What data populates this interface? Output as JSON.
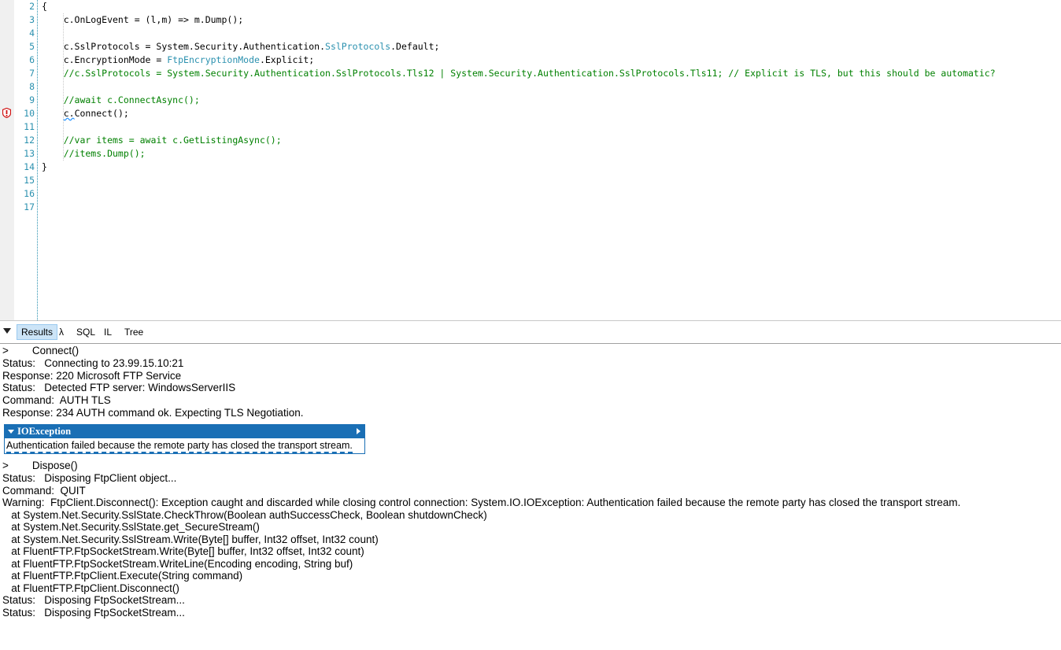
{
  "editor": {
    "lines": [
      {
        "n": "2",
        "segments": [
          {
            "t": "{",
            "c": ""
          }
        ]
      },
      {
        "n": "3",
        "segments": [
          {
            "t": "    c.OnLogEvent = (l,m) => m.Dump();",
            "c": ""
          }
        ]
      },
      {
        "n": "4",
        "segments": [
          {
            "t": "",
            "c": ""
          }
        ]
      },
      {
        "n": "5",
        "segments": [
          {
            "t": "    c.SslProtocols = System.Security.Authentication.",
            "c": ""
          },
          {
            "t": "SslProtocols",
            "c": "type"
          },
          {
            "t": ".Default;",
            "c": ""
          }
        ]
      },
      {
        "n": "6",
        "segments": [
          {
            "t": "    c.EncryptionMode = ",
            "c": ""
          },
          {
            "t": "FtpEncryptionMode",
            "c": "type"
          },
          {
            "t": ".Explicit;",
            "c": ""
          }
        ]
      },
      {
        "n": "7",
        "segments": [
          {
            "t": "    //c.SslProtocols = System.Security.Authentication.SslProtocols.Tls12 | System.Security.Authentication.SslProtocols.Tls11; // Explicit is TLS, but this should be automatic?",
            "c": "comment"
          }
        ]
      },
      {
        "n": "8",
        "segments": [
          {
            "t": "",
            "c": ""
          }
        ]
      },
      {
        "n": "9",
        "segments": [
          {
            "t": "    //await c.ConnectAsync();",
            "c": "comment"
          }
        ]
      },
      {
        "n": "10",
        "segments": [
          {
            "t": "    ",
            "c": ""
          },
          {
            "t": "c.",
            "c": "squiggle"
          },
          {
            "t": "Connect();",
            "c": ""
          }
        ]
      },
      {
        "n": "11",
        "segments": [
          {
            "t": "",
            "c": ""
          }
        ]
      },
      {
        "n": "12",
        "segments": [
          {
            "t": "    //var items = await c.GetListingAsync();",
            "c": "comment"
          }
        ]
      },
      {
        "n": "13",
        "segments": [
          {
            "t": "    //items.Dump();",
            "c": "comment"
          }
        ]
      },
      {
        "n": "14",
        "segments": [
          {
            "t": "}",
            "c": ""
          }
        ]
      },
      {
        "n": "15",
        "segments": [
          {
            "t": "",
            "c": ""
          }
        ]
      },
      {
        "n": "16",
        "segments": [
          {
            "t": "",
            "c": ""
          }
        ]
      },
      {
        "n": "17",
        "segments": [
          {
            "t": "",
            "c": ""
          }
        ]
      }
    ]
  },
  "results_bar": {
    "results_tab": "Results",
    "lambda_tab": "λ",
    "sql_tab": "SQL",
    "il_tab": "IL",
    "tree_tab": "Tree"
  },
  "output": {
    "connect_block": [
      ">        Connect()",
      "Status:   Connecting to 23.99.15.10:21",
      "Response: 220 Microsoft FTP Service",
      "Status:   Detected FTP server: WindowsServerIIS",
      "Command:  AUTH TLS",
      "Response: 234 AUTH command ok. Expecting TLS Negotiation."
    ],
    "exception": {
      "title": "IOException",
      "message": "Authentication failed because the remote party has closed the transport stream."
    },
    "dispose_block": [
      ">        Dispose()",
      "Status:   Disposing FtpClient object...",
      "Command:  QUIT",
      "Warning:  FtpClient.Disconnect(): Exception caught and discarded while closing control connection: System.IO.IOException: Authentication failed because the remote party has closed the transport stream.",
      "   at System.Net.Security.SslState.CheckThrow(Boolean authSuccessCheck, Boolean shutdownCheck)",
      "   at System.Net.Security.SslState.get_SecureStream()",
      "   at System.Net.Security.SslStream.Write(Byte[] buffer, Int32 offset, Int32 count)",
      "   at FluentFTP.FtpSocketStream.Write(Byte[] buffer, Int32 offset, Int32 count)",
      "   at FluentFTP.FtpSocketStream.WriteLine(Encoding encoding, String buf)",
      "   at FluentFTP.FtpClient.Execute(String command)",
      "   at FluentFTP.FtpClient.Disconnect()",
      "Status:   Disposing FtpSocketStream...",
      "Status:   Disposing FtpSocketStream..."
    ]
  },
  "colors": {
    "line_number": "#2b91af",
    "type_name": "#2b91af",
    "comment": "#008000",
    "exception_header": "#1a6fb5",
    "selected_tab": "#cce4f7"
  }
}
